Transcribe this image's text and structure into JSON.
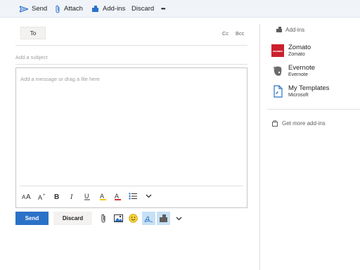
{
  "toolbar": {
    "send_label": "Send",
    "attach_label": "Attach",
    "addins_label": "Add-ins",
    "discard_label": "Discard",
    "more_label": "•••"
  },
  "compose": {
    "to_label": "To",
    "cc_label": "Cc",
    "bcc_label": "Bcc",
    "subject_placeholder": "Add a subject",
    "body_placeholder": "Add a message or drag a file here"
  },
  "actions": {
    "send_label": "Send",
    "discard_label": "Discard"
  },
  "addins_pane": {
    "title": "Add-ins",
    "items": [
      {
        "name": "Zomato",
        "publisher": "Zomato",
        "icon": "zomato-logo",
        "icon_text": "zomato"
      },
      {
        "name": "Evernote",
        "publisher": "Evernote",
        "icon": "evernote-logo"
      },
      {
        "name": "My Templates",
        "publisher": "Microsoft",
        "icon": "templates-icon"
      }
    ],
    "get_more_label": "Get more add-ins"
  },
  "colors": {
    "accent": "#2b71c8",
    "toolbar_bg": "#f0f4f9",
    "zomato_red": "#cb202d",
    "selected_tool_bg": "#c7e0f4"
  }
}
